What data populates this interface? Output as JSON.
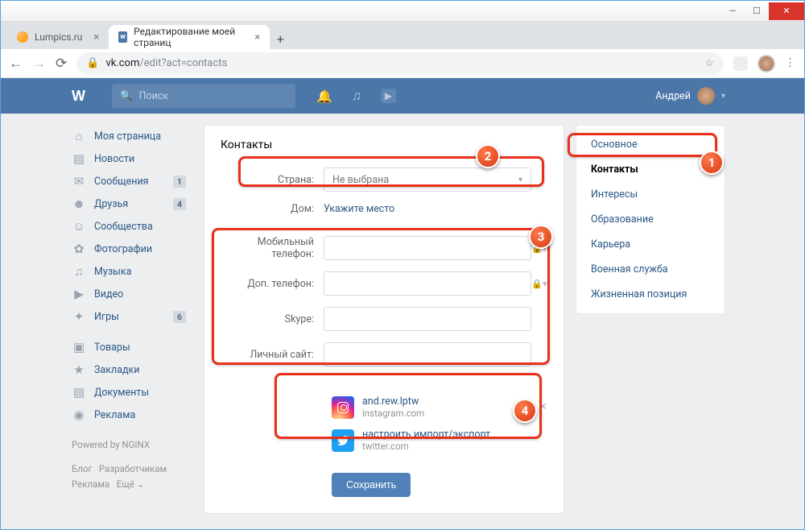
{
  "browser": {
    "tabs": [
      {
        "title": "Lumpics.ru"
      },
      {
        "title": "Редактирование моей страниц"
      }
    ],
    "url_host": "vk.com",
    "url_path": "/edit?act=contacts"
  },
  "vk": {
    "search_placeholder": "Поиск",
    "user_name": "Андрей"
  },
  "leftnav": {
    "items": [
      {
        "icon": "⌂",
        "label": "Моя страница"
      },
      {
        "icon": "▤",
        "label": "Новости"
      },
      {
        "icon": "✉",
        "label": "Сообщения",
        "badge": "1"
      },
      {
        "icon": "☻",
        "label": "Друзья",
        "badge": "4"
      },
      {
        "icon": "☺",
        "label": "Сообщества"
      },
      {
        "icon": "✿",
        "label": "Фотографии"
      },
      {
        "icon": "♫",
        "label": "Музыка"
      },
      {
        "icon": "▶",
        "label": "Видео"
      },
      {
        "icon": "✦",
        "label": "Игры",
        "badge": "6"
      }
    ],
    "items2": [
      {
        "icon": "▣",
        "label": "Товары"
      },
      {
        "icon": "★",
        "label": "Закладки"
      },
      {
        "icon": "▤",
        "label": "Документы"
      },
      {
        "icon": "◉",
        "label": "Реклама"
      }
    ],
    "powered": "Powered by NGINX",
    "foot": {
      "blog": "Блог",
      "dev": "Разработчикам",
      "ads": "Реклама",
      "more": "Ещё ⌄"
    }
  },
  "form": {
    "title": "Контакты",
    "country_label": "Страна:",
    "country_value": "Не выбрана",
    "home_label": "Дом:",
    "home_value": "Укажите место",
    "mobile_label": "Мобильный телефон:",
    "alt_label": "Доп. телефон:",
    "skype_label": "Skype:",
    "site_label": "Личный сайт:",
    "insta_name": "and.rew.lptw",
    "insta_domain": "instagram.com",
    "tw_name": "настроить импорт/экспорт",
    "tw_domain": "twitter.com",
    "save": "Сохранить"
  },
  "rightnav": {
    "items": [
      "Основное",
      "Контакты",
      "Интересы",
      "Образование",
      "Карьера",
      "Военная служба",
      "Жизненная позиция"
    ]
  },
  "anno": {
    "n1": "1",
    "n2": "2",
    "n3": "3",
    "n4": "4"
  }
}
